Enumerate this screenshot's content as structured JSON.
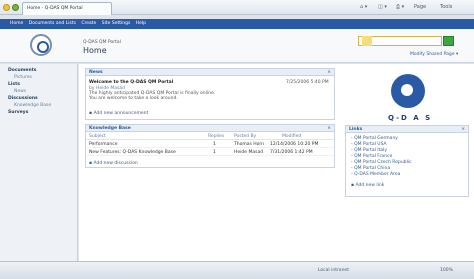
{
  "browser": {
    "tab_title": "Home - Q-DAS QM Portal",
    "toolbar_items": [
      "Page",
      "Tools"
    ]
  },
  "topnav": {
    "items": [
      "Home",
      "Documents and Lists",
      "Create",
      "Site Settings",
      "Help"
    ]
  },
  "header": {
    "breadcrumb": "Q-DAS QM Portal",
    "title": "Home",
    "modify_label": "Modify Shared Page ▾"
  },
  "left_nav": [
    {
      "label": "Documents",
      "kind": "head"
    },
    {
      "label": "Pictures",
      "kind": "sub"
    },
    {
      "label": "Lists",
      "kind": "head"
    },
    {
      "label": "News",
      "kind": "sub"
    },
    {
      "label": "Discussions",
      "kind": "head"
    },
    {
      "label": "Knowledge Base",
      "kind": "sub"
    },
    {
      "label": "Surveys",
      "kind": "head"
    }
  ],
  "news": {
    "title": "News",
    "item_title": "Welcome to the Q-DAS QM Portal",
    "date": "7/25/2006 5:40 PM",
    "author": "by Heide Masad",
    "body_line1": "The highly anticipated Q-DAS QM Portal is finally online.",
    "body_line2": "You are welcome to take a look around.",
    "add_link": "Add new announcement"
  },
  "knowledge_base": {
    "title": "Knowledge Base",
    "columns": [
      "Subject",
      "Replies",
      "Posted By",
      "Modified"
    ],
    "rows": [
      {
        "subject": "Performance",
        "replies": "1",
        "posted_by": "Thomas Horn",
        "modified": "12/14/2006 10:20 PM"
      },
      {
        "subject": "New Features: Q-DAS Knowledge Base",
        "replies": "1",
        "posted_by": "Heide Masad",
        "modified": "7/31/2006 1:42 PM"
      }
    ],
    "add_link": "Add new discussion"
  },
  "brand": {
    "text": "Q-D A S"
  },
  "links": {
    "title": "Links",
    "items": [
      "QM Portal Germany",
      "QM Portal USA",
      "QM Portal Italy",
      "QM Portal France",
      "QM Portal Czech Republic",
      "QM Portal China",
      "Q-DAS Member Area"
    ],
    "add_link": "Add new link"
  },
  "status_bar": {
    "zone": "Local intranet",
    "zoom": "100%"
  }
}
